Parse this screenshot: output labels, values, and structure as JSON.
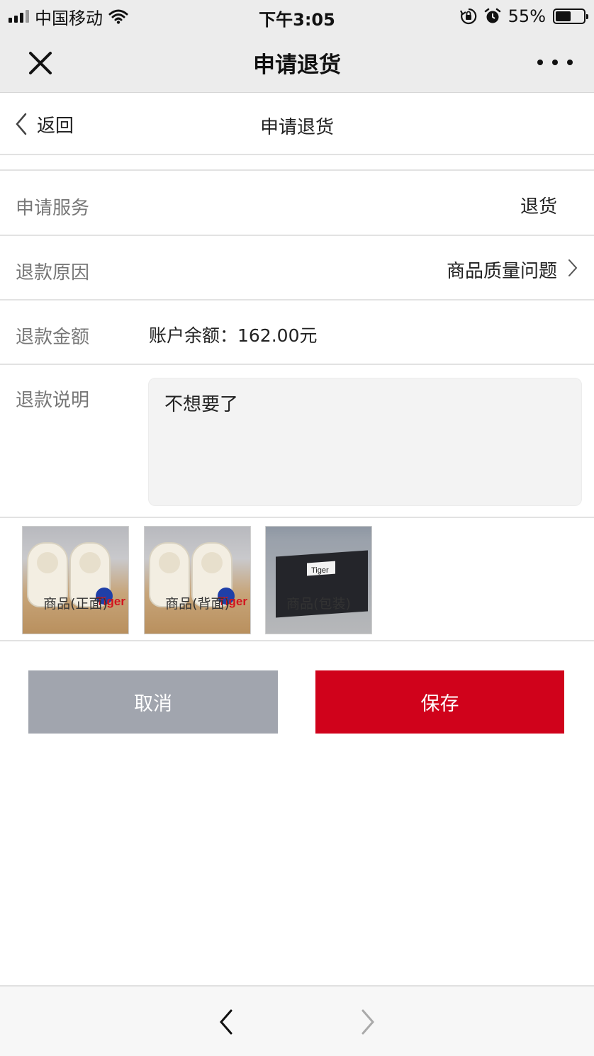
{
  "status_bar": {
    "carrier": "中国移动",
    "time": "下午3:05",
    "battery_percent": "55%",
    "battery_level": 0.55
  },
  "title_bar": {
    "title": "申请退货",
    "close_icon": "close-icon",
    "more_icon": "more-icon"
  },
  "page_header": {
    "back_label": "返回",
    "title": "申请退货"
  },
  "form": {
    "service": {
      "label": "申请服务",
      "value": "退货"
    },
    "reason": {
      "label": "退款原因",
      "value": "商品质量问题"
    },
    "amount": {
      "label": "退款金额",
      "value": "账户余额：162.00元"
    },
    "description": {
      "label": "退款说明",
      "value": "不想要了"
    }
  },
  "photos": [
    {
      "caption": "商品(正面)",
      "brand": "Tiger"
    },
    {
      "caption": "商品(背面)",
      "brand": "Tiger"
    },
    {
      "caption": "商品(包装)",
      "brand": "Tiger"
    }
  ],
  "buttons": {
    "cancel": "取消",
    "save": "保存"
  },
  "colors": {
    "save": "#d0021b",
    "cancel": "#a1a5ae",
    "title_bar": "#ececec"
  },
  "bottom_nav": {
    "back_icon": "chevron-left-icon",
    "forward_icon": "chevron-right-icon"
  }
}
